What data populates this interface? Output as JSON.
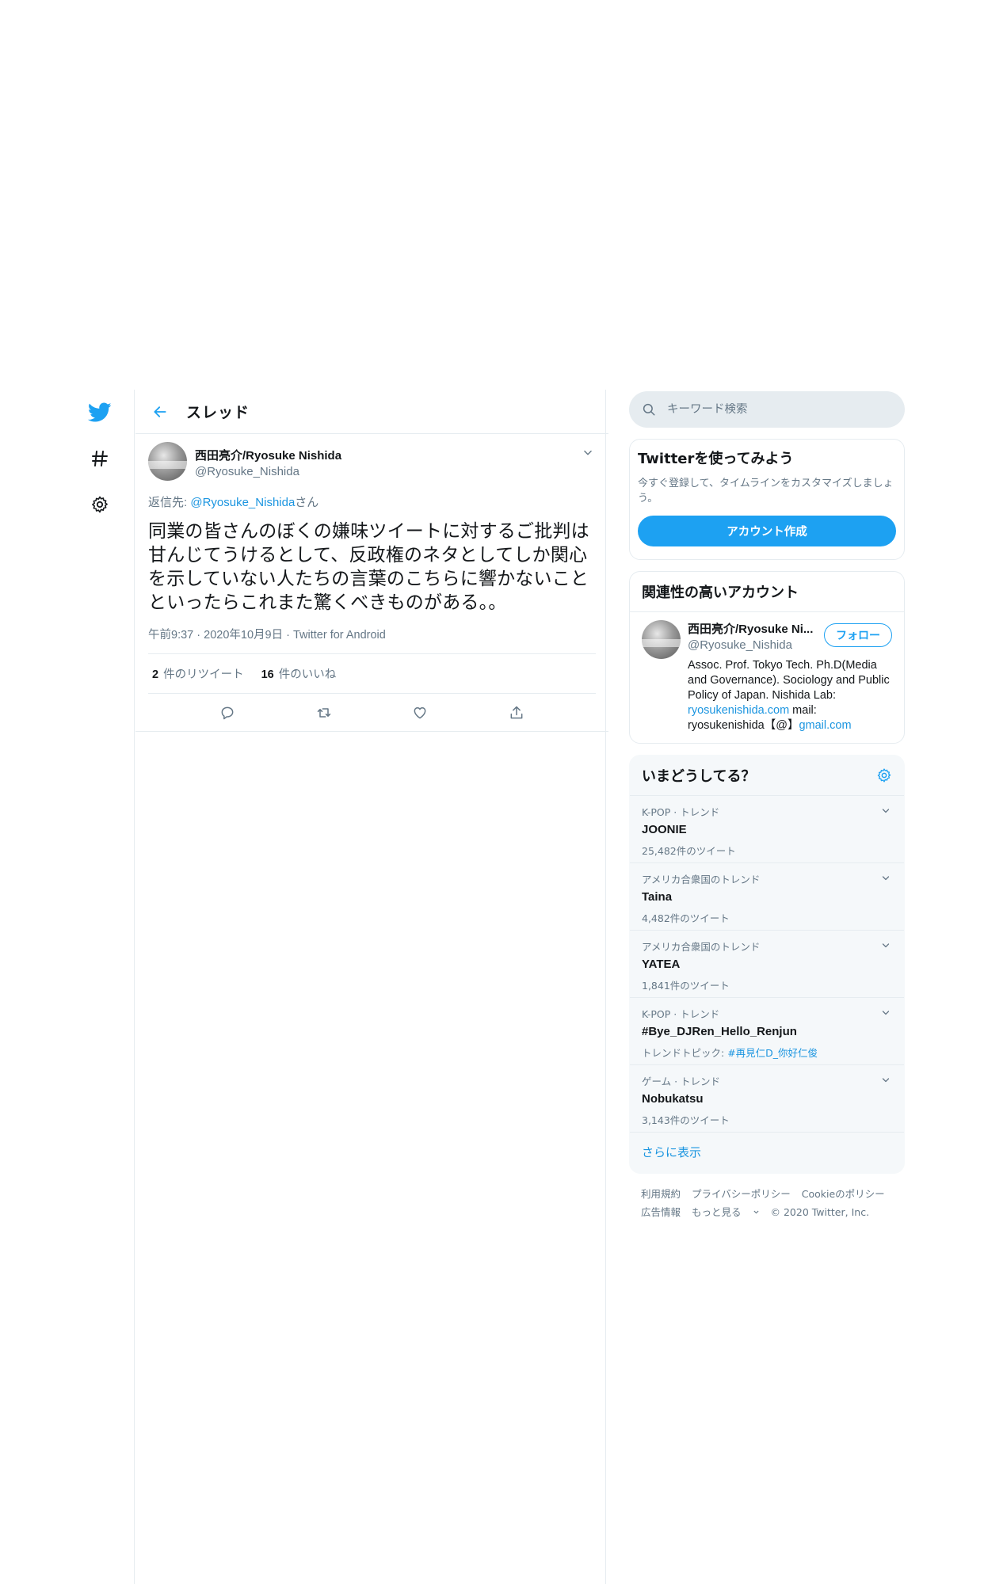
{
  "header": {
    "title": "スレッド"
  },
  "tweet": {
    "display_name": "西田亮介/Ryosuke Nishida",
    "handle": "@Ryosuke_Nishida",
    "reply_prefix": "返信先: ",
    "reply_handle": "@Ryosuke_Nishida",
    "reply_suffix": "さん",
    "text": "同業の皆さんのぼくの嫌味ツイートに対するご批判は甘んじてうけるとして、反政権のネタとしてしか関心を示していない人たちの言葉のこちらに響かないことといったらこれまた驚くべきものがある。。",
    "time": "午前9:37",
    "date": "2020年10月9日",
    "source": "Twitter for Android",
    "retweet_count": "2",
    "retweet_label": "件のリツイート",
    "like_count": "16",
    "like_label": "件のいいね"
  },
  "search": {
    "placeholder": "キーワード検索"
  },
  "signup_card": {
    "title": "Twitterを使ってみよう",
    "subtitle": "今すぐ登録して、タイムラインをカスタマイズしましょう。",
    "button": "アカウント作成"
  },
  "related": {
    "title": "関連性の高いアカウント",
    "name": "西田亮介/Ryosuke Ni...",
    "handle": "@Ryosuke_Nishida",
    "follow": "フォロー",
    "bio_text": "Assoc. Prof. Tokyo Tech. Ph.D(Media and Governance). Sociology and Public Policy of Japan. Nishida Lab: ",
    "bio_link": "ryosukenishida.com",
    "bio_mail": " mail: ryosukenishida【@】",
    "bio_link2": "gmail.com"
  },
  "trends": {
    "title": "いまどうしてる？",
    "items": [
      {
        "context": "K-POP · トレンド",
        "name": "JOONIE",
        "count": "25,482件のツイート"
      },
      {
        "context": "アメリカ合衆国のトレンド",
        "name": "Taina",
        "count": "4,482件のツイート"
      },
      {
        "context": "アメリカ合衆国のトレンド",
        "name": "YATEA",
        "count": "1,841件のツイート"
      },
      {
        "context": "K-POP · トレンド",
        "name": "#Bye_DJRen_Hello_Renjun",
        "count_prefix": "トレンドトピック: ",
        "count_link": "#再見仁D_你好仁俊"
      },
      {
        "context": "ゲーム · トレンド",
        "name": "Nobukatsu",
        "count": "3,143件のツイート"
      }
    ],
    "show_more": "さらに表示"
  },
  "footer": {
    "terms": "利用規約",
    "privacy": "プライバシーポリシー",
    "cookies": "Cookieのポリシー",
    "ads": "広告情報",
    "more": "もっと見る",
    "copyright": "© 2020 Twitter, Inc."
  },
  "colors": {
    "accent": "#1da1f2",
    "link": "#1b95e0",
    "muted": "#657786",
    "border": "#e6ecf0"
  },
  "icons": [
    "twitter-logo-icon",
    "hashtag-icon",
    "gear-icon",
    "back-arrow-icon",
    "chevron-down-icon",
    "reply-icon",
    "retweet-icon",
    "like-icon",
    "share-icon",
    "search-icon"
  ]
}
